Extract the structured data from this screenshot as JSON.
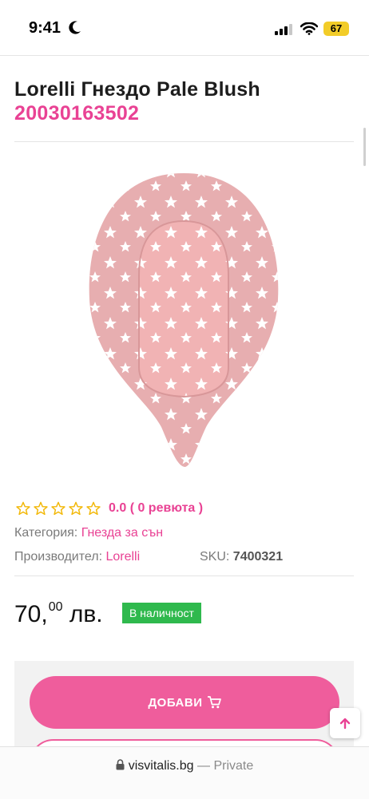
{
  "status_bar": {
    "time": "9:41",
    "battery": "67"
  },
  "product": {
    "title": "Lorelli Гнездо Pale Blush",
    "code": "20030163502",
    "rating_text": "0.0 ( 0 ревюта )",
    "category_label": "Категория:",
    "category_value": "Гнезда за сън",
    "manufacturer_label": "Производител:",
    "manufacturer_value": "Lorelli",
    "sku_label": "SKU:",
    "sku_value": "7400321",
    "price_main": "70,",
    "price_cents": "00",
    "price_currency": "лв.",
    "stock": "В наличност"
  },
  "actions": {
    "add_to_cart": "ДОБАВИ"
  },
  "browser": {
    "domain": "visvitalis.bg",
    "privacy": "— Private"
  },
  "colors": {
    "accent": "#e94294",
    "button": "#ef5d9c",
    "stock": "#2fb94d",
    "star": "#f2b705"
  },
  "icons": [
    "moon-icon",
    "signal-icon",
    "wifi-icon",
    "star-icon",
    "cart-icon",
    "arrow-up-icon",
    "lock-icon"
  ]
}
